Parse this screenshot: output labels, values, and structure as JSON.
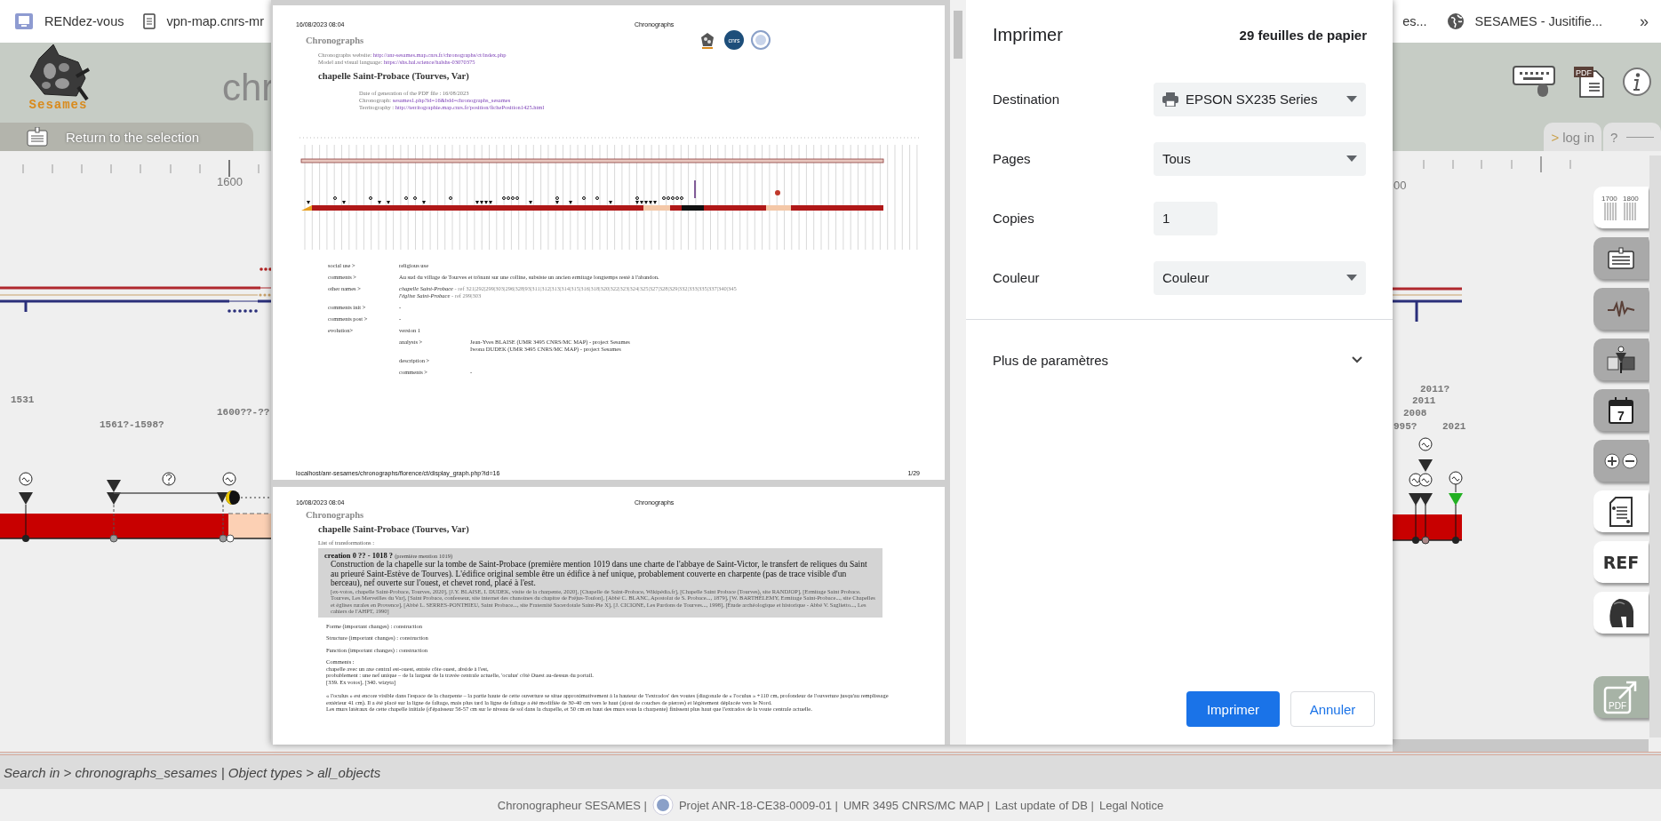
{
  "bookmarks_bar": {
    "items": [
      {
        "label": "RENdez-vous",
        "kind": "app"
      },
      {
        "label": "vpn-map.cnrs-mr",
        "kind": "page"
      }
    ],
    "right_items": [
      {
        "label": "es...",
        "kind": "plain"
      },
      {
        "label": "SESAMES - Jusitifie...",
        "kind": "globe"
      }
    ],
    "overflow": "»"
  },
  "app_header": {
    "logo_text": "Sesames",
    "title": "chr",
    "return_button": "Return to the selection",
    "pdf_icon_label": "PDF",
    "login_tab": {
      "arrow": ">",
      "label": "log in"
    },
    "help_tab": "?"
  },
  "timeline": {
    "ruler_labels": [
      "1600",
      "00"
    ],
    "date_labels": [
      "1531",
      "1561?-1598?",
      "1600??-??",
      "2011?",
      "2011",
      "2008",
      "995?",
      "2021"
    ]
  },
  "sidebar_tools": [
    {
      "kind": "scale",
      "active": true,
      "labels": [
        "1700",
        "1800"
      ]
    },
    {
      "kind": "card",
      "active": false
    },
    {
      "kind": "pulse",
      "active": false
    },
    {
      "kind": "node",
      "active": false
    },
    {
      "kind": "calendar",
      "active": false,
      "label": "7"
    },
    {
      "kind": "zoom",
      "active": false
    },
    {
      "kind": "quote",
      "active": true
    },
    {
      "kind": "ref",
      "active": true,
      "label": "REF"
    },
    {
      "kind": "helmet",
      "active": true
    },
    {
      "kind": "pdf",
      "active": false,
      "label": "PDF"
    }
  ],
  "status_bar": {
    "search_text": "Search in > chronographs_sesames | Object types > all_objects"
  },
  "footer": {
    "items": [
      "Chronographeur SESAMES |",
      "Projet ANR-18-CE38-0009-01 |",
      "UMR 3495 CNRS/MC MAP |",
      "Last update of DB |",
      "Legal Notice"
    ]
  },
  "preview": {
    "page_1": {
      "date": "16/08/2023 08:04",
      "header_title": "Chronographs",
      "brand": "Chronographs",
      "logos": [
        {
          "kind": "figure"
        },
        {
          "kind": "disc",
          "label": "cnrs"
        },
        {
          "kind": "ring"
        }
      ],
      "links": [
        {
          "label": "Chronographs website:",
          "url": "http://anr-sesames.map.cnrs.fr/chronographs/ct/index.php"
        },
        {
          "label": "Model and visual language:",
          "url": "https://shs.hal.science/halshs-03070375"
        }
      ],
      "title": "chapelle Saint-Probace (Tourves, Var)",
      "meta": [
        {
          "label": "Date of generation of the PDF file : 16/08/2023"
        },
        {
          "label": "Chronograph:",
          "url": "sesames1.php?id=16&bdd=chronographs_sesames"
        },
        {
          "label": "Territography :",
          "url": "http://territographie.map.cnrs.fr/position/fichePosition1425.html"
        }
      ],
      "fields": [
        {
          "label": "social use >",
          "value": "religious use"
        },
        {
          "label": "comments >",
          "value": "Au sud du village de Tourves et trônant sur une colline, subsiste un ancien ermitage longtemps resté à l'abandon."
        },
        {
          "label": "other names >",
          "names": [
            {
              "name": "chapelle Saint-Probace",
              "refs": "- ref 321|292|299|303|296|328|93|311|312|313|314|315|316|318|320|322|323|324|325|327|328|329|332|333|335|337|340|345"
            },
            {
              "name": "l'église Saint-Probace",
              "refs": "- ref 299|303"
            }
          ]
        },
        {
          "label": "comments init >",
          "value": "-"
        },
        {
          "label": "comments post >",
          "value": "-"
        },
        {
          "label": "evolution>",
          "value": "version 1",
          "children": [
            {
              "label": "analysts >",
              "lines": [
                "Jean-Yves BLAISE (UMR 3495 CNRS/MC MAP) - project Sesames",
                "Iwona DUDEK (UMR 3495 CNRS/MC MAP) - project Sesames"
              ]
            },
            {
              "label": "description >"
            },
            {
              "label": "comments >",
              "lines": [
                "-"
              ]
            }
          ]
        }
      ],
      "footer_url": "localhost/anr-sesames/chronographs/florence/ct/display_graph.php?id=16",
      "page_number": "1/29"
    },
    "page_2": {
      "date": "16/08/2023 08:04",
      "header_title": "Chronographs",
      "brand": "Chronographs",
      "title": "chapelle Saint-Probace (Tourves, Var)",
      "list_heading": "List of transformations :",
      "transformation": {
        "heading": "creation 0 ?? - 1018 ?",
        "note": "(première mention 1019)",
        "description": "Construction de la chapelle sur la tombe de Saint-Probace (première mention 1019 dans une charte de l'abbaye de Saint-Victor, le transfert de reliques du Saint au prieuré Saint-Estève de Tourves). L'édifice original semble être un édifice à nef unique, probablement couverte en charpente (pas de trace visible d'un berceau), nef ouverte sur l'ouest, et chevet rond, placé à l'est.",
        "sources": "[ex-votos, chapelle Saint-Probace, Tourves, 2020], [J.Y. BLAISE, I. DUDEK, visite de la charpente, 2020], [Chapelle de Saint-Probace, Wikipédia.fr], [Chapelle Saint Probace (Tourves), site RANDJOP], [Ermitage Saint Probace. Tourves, Les Merveilles du Var], [Saint Probace, confesseur, site internet des chanoines du chapitre de Fréjus-Toulon], [Abbé C. BLANC, Apostolat de S. Probace..., 1879], [W. BARTHÉLEMY, Ermitage Saint-Probace..., site Chapelles et églises rurales en Provence], [Abbé L. SERRES-PONTHIEU, Saint Probace..., site Fraternité Sacerdotale Saint-Pie X], [J. CICIONE, Les Pardons de Tourves..., 1998], [Étude archéologique et historique - Abbé V. Saglietto..., Les cahiers de l'AHPT, 1990]"
      },
      "changes": [
        "Forme (important changes) : construction",
        "Structure (important changes) : construction",
        "Function (important changes) : construction"
      ],
      "comments_heading": "Comments :",
      "comments": [
        "chapelle avec un axe central est-ouest, entrée côte ouest, abside à l'est,",
        "probablement : une nef unique – de la largeur de la travée centrale actuelle, 'oculus' côté Ouest au-dessus du portail.",
        "[339. Ex votos], [340. wizyta]"
      ],
      "paragraphs": [
        "« l'oculus » est encore visible dans l'espace de la charpente – la partie haute de cette ouverture se situe approximativement à la hauteur de 'l'extrados' des voutes (diagonale de « l'oculus » +110 cm, profondeur de l'ouverture jusqu'au remplissage extérieur 41 cm). Il a été placé sur la ligne de faîtage, mais plus tard la ligne de faîtage a été modifiée de 30-40 cm vers le haut (ajout de couches de pierres) et légèrement déplacée vers le Nord.",
        "Les murs latéraux de cette chapelle initiale (d'épaisseur 56-57 cm sur le niveau de sol dans la chapelle, et 50 cm en haut des murs sous la charpente) finissent plus haut que l'extrados de la voute centrale actuelle."
      ]
    }
  },
  "print_dialog": {
    "title": "Imprimer",
    "sheets": "29 feuilles de papier",
    "settings": [
      {
        "label": "Destination",
        "kind": "printer",
        "value": "EPSON SX235 Series"
      },
      {
        "label": "Pages",
        "kind": "select",
        "value": "Tous"
      },
      {
        "label": "Copies",
        "kind": "number",
        "value": "1"
      },
      {
        "label": "Couleur",
        "kind": "select",
        "value": "Couleur"
      }
    ],
    "more_settings": {
      "label": "Plus de paramètres",
      "expanded": false
    },
    "buttons": [
      {
        "label": "Imprimer",
        "kind": "primary"
      },
      {
        "label": "Annuler",
        "kind": "secondary"
      }
    ]
  }
}
